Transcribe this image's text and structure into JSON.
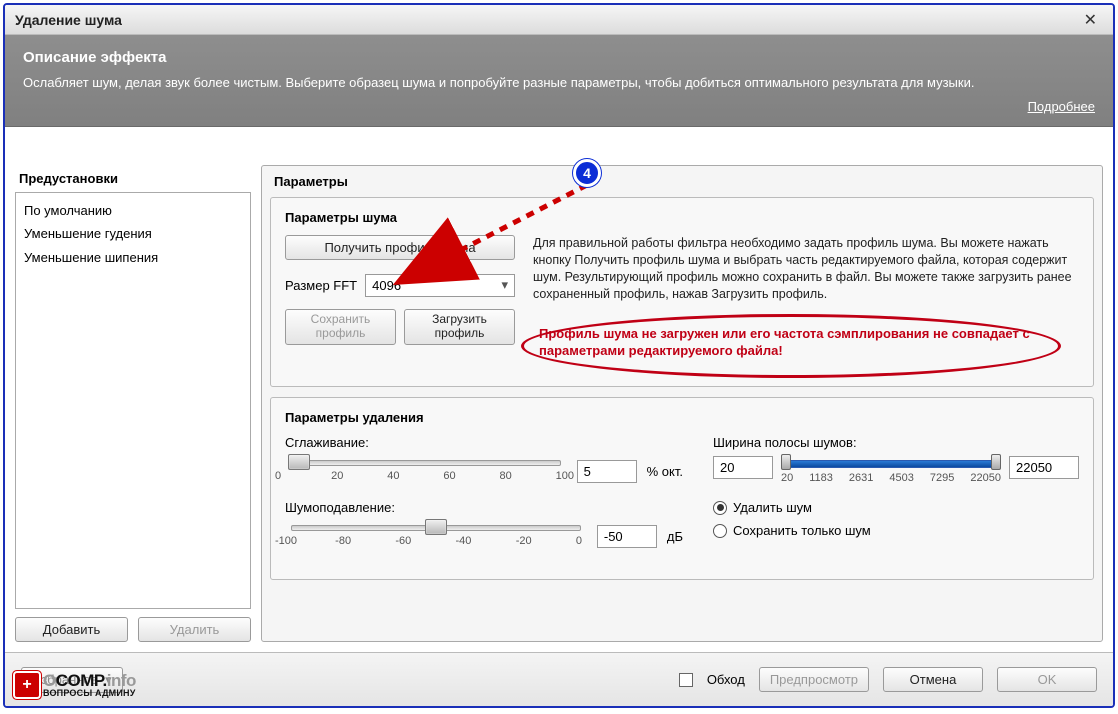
{
  "window": {
    "title": "Удаление шума"
  },
  "desc": {
    "title": "Описание эффекта",
    "text": "Ослабляет шум, делая звук более чистым. Выберите образец шума и попробуйте разные параметры, чтобы добиться оптимального результата для музыки.",
    "more": "Подробнее"
  },
  "presets": {
    "title": "Предустановки",
    "items": [
      "По умолчанию",
      "Уменьшение гудения",
      "Уменьшение шипения"
    ],
    "add": "Добавить",
    "remove": "Удалить"
  },
  "params": {
    "title": "Параметры",
    "noise": {
      "title": "Параметры шума",
      "get_profile": "Получить профиль шума",
      "fft_label": "Размер FFT",
      "fft_value": "4096",
      "save_profile": "Сохранить профиль",
      "load_profile": "Загрузить профиль",
      "help_text": "Для правильной работы фильтра необходимо задать профиль шума. Вы можете нажать кнопку Получить профиль шума и выбрать часть редактируемого файла, которая содержит шум. Результирующий профиль можно сохранить в файл. Вы можете также загрузить ранее сохраненный профиль, нажав Загрузить профиль.",
      "warning": "Профиль шума не загружен или его частота сэмплирования не совпадает с параметрами редактируемого файла!"
    },
    "removal": {
      "title": "Параметры удаления",
      "smoothing": {
        "label": "Сглаживание:",
        "value": "5",
        "unit": "% окт.",
        "ticks": [
          "0",
          "20",
          "40",
          "60",
          "80",
          "100"
        ],
        "pos_pct": 5
      },
      "reduction": {
        "label": "Шумоподавление:",
        "value": "-50",
        "unit": "дБ",
        "ticks": [
          "-100",
          "-80",
          "-60",
          "-40",
          "-20",
          "0"
        ],
        "pos_pct": 50
      },
      "noise_width": {
        "label": "Ширина полосы шумов:",
        "low": "20",
        "high": "22050",
        "ticks": [
          "20",
          "1183",
          "2631",
          "4503",
          "7295",
          "22050"
        ]
      },
      "mode": {
        "remove": "Удалить шум",
        "keep": "Сохранить только шум",
        "selected": "remove"
      }
    }
  },
  "footer": {
    "favorites": "Избранное",
    "bypass": "Обход",
    "preview": "Предпросмотр",
    "cancel": "Отмена",
    "ok": "OK"
  },
  "annotation": {
    "badge": "4"
  },
  "watermark": {
    "brand_faded": "O",
    "brand": "COMP.",
    "brand_tail": "info",
    "sub": "ВОПРОСЫ АДМИНУ"
  }
}
